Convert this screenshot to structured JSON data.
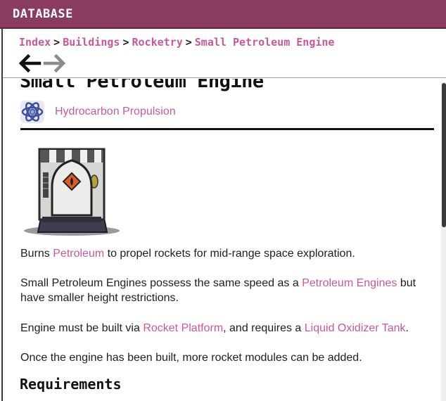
{
  "window": {
    "title": "DATABASE"
  },
  "breadcrumb": [
    {
      "label": "Index"
    },
    {
      "label": "Buildings"
    },
    {
      "label": "Rocketry"
    },
    {
      "label": "Small Petroleum Engine"
    }
  ],
  "breadcrumb_separator": ">",
  "nav": {
    "back_icon": "arrow-left-icon",
    "forward_icon": "arrow-right-icon"
  },
  "page": {
    "title": "Small Petroleum Engine",
    "category": {
      "icon": "atom-icon",
      "label": "Hydrocarbon Propulsion"
    },
    "image": "small-petroleum-engine-image"
  },
  "paragraphs": {
    "p1": {
      "pre": "Burns ",
      "link": "Petroleum",
      "post": " to propel rockets for mid-range space exploration."
    },
    "p2": {
      "pre": "Small Petroleum Engines possess the same speed as a ",
      "link": "Petroleum Engines",
      "post": " but have smaller height restrictions."
    },
    "p3": {
      "pre": "Engine must be built via ",
      "link1": "Rocket Platform",
      "mid": ", and requires a ",
      "link2": "Liquid Oxidizer Tank",
      "post": "."
    },
    "p4": {
      "text": "Once the engine has been built, more rocket modules can be added."
    }
  },
  "sections": {
    "requirements": "Requirements"
  },
  "colors": {
    "titlebar": "#8a3b60",
    "link": "#c7599a",
    "text": "#1e1e1e"
  }
}
